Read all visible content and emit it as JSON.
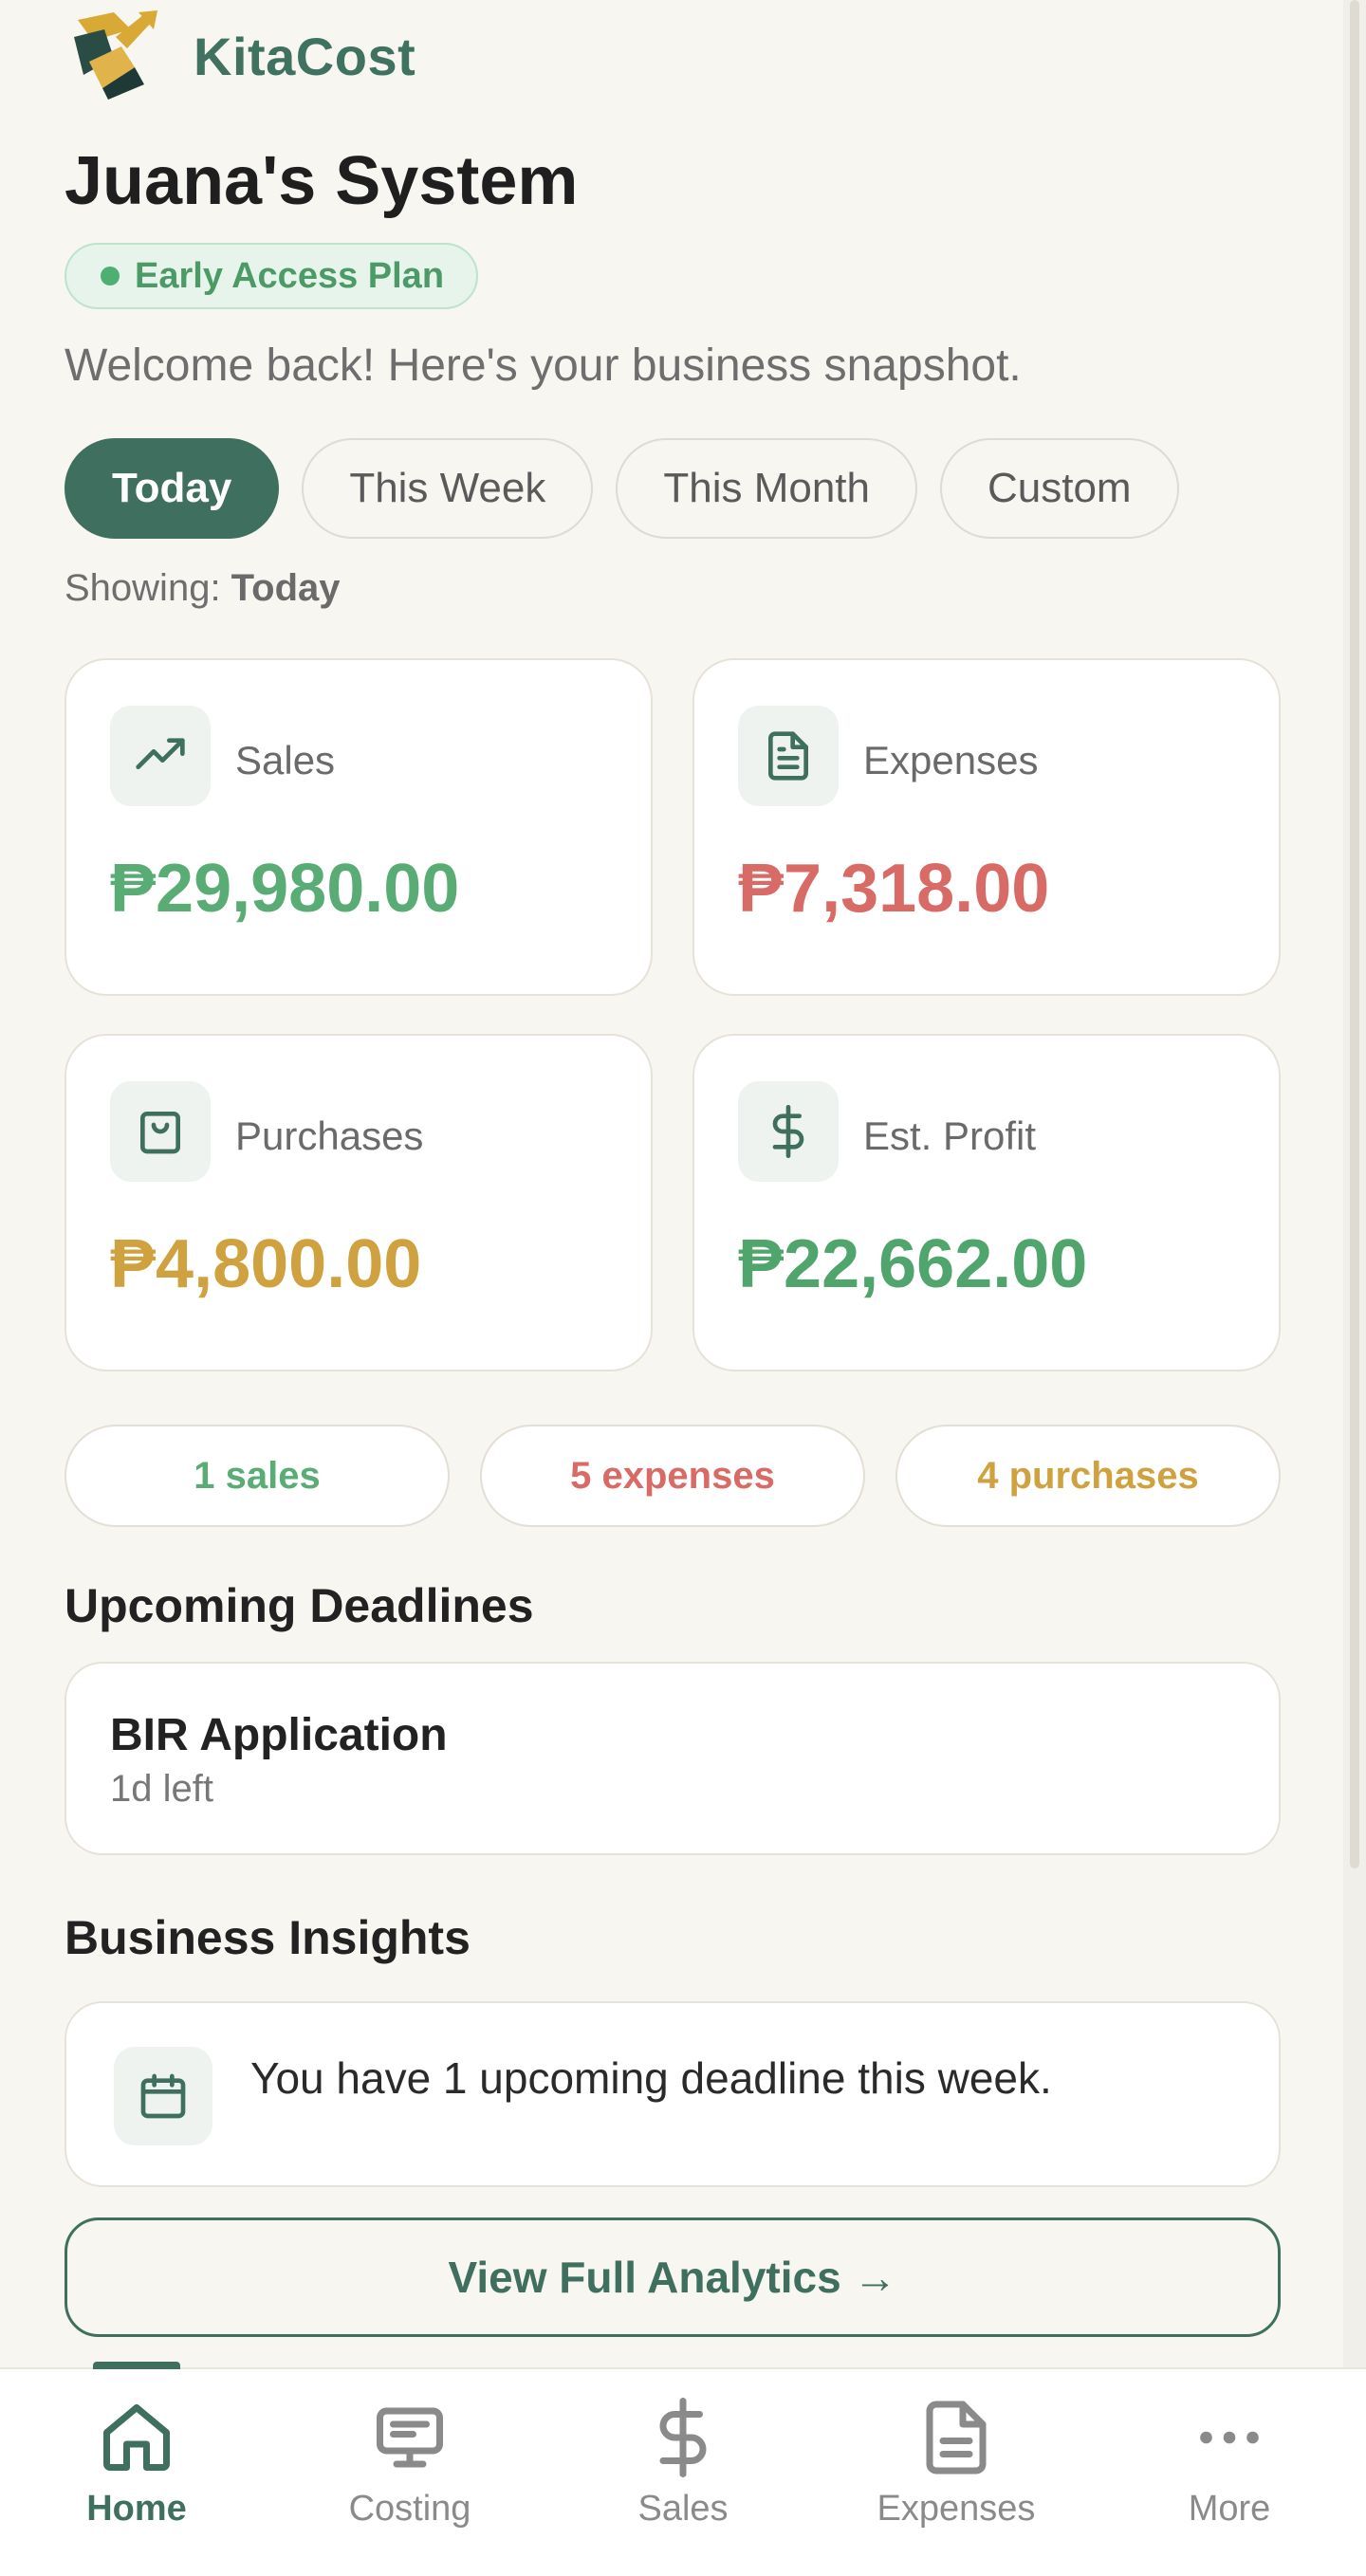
{
  "app": {
    "brand_name": "KitaCost",
    "title": "Juana's System",
    "plan_badge": "Early Access Plan",
    "welcome": "Welcome back! Here's your business snapshot."
  },
  "filters": {
    "options": [
      "Today",
      "This Week",
      "This Month",
      "Custom"
    ],
    "selected": "Today",
    "showing_prefix": "Showing: ",
    "showing_value": "Today"
  },
  "stats": [
    {
      "label": "Sales",
      "value": "₱29,980.00",
      "icon": "trending-up-icon",
      "color": "#59ad74"
    },
    {
      "label": "Expenses",
      "value": "₱7,318.00",
      "icon": "document-icon",
      "color": "#d96b66"
    },
    {
      "label": "Purchases",
      "value": "₱4,800.00",
      "icon": "shopping-bag-icon",
      "color": "#cfa23f"
    },
    {
      "label": "Est. Profit",
      "value": "₱22,662.00",
      "icon": "dollar-icon",
      "color": "#4fa56c"
    }
  ],
  "counts": [
    "1 sales",
    "5 expenses",
    "4 purchases"
  ],
  "deadlines": {
    "title": "Upcoming Deadlines",
    "items": [
      {
        "name": "BIR Application",
        "remaining": "1d left"
      }
    ]
  },
  "insights": {
    "title": "Business Insights",
    "items": [
      {
        "icon": "calendar-icon",
        "text": "You have 1 upcoming deadline this week."
      }
    ]
  },
  "analytics_button": "View Full Analytics →",
  "nav": {
    "items": [
      {
        "label": "Home",
        "icon": "home-icon",
        "active": true
      },
      {
        "label": "Costing",
        "icon": "monitor-icon",
        "active": false
      },
      {
        "label": "Sales",
        "icon": "dollar-icon",
        "active": false
      },
      {
        "label": "Expenses",
        "icon": "document-icon",
        "active": false
      },
      {
        "label": "More",
        "icon": "more-dots-icon",
        "active": false
      }
    ]
  },
  "colors": {
    "brand": "#3e6f5f",
    "background": "#f8f6f1",
    "sales": "#59ad74",
    "expenses": "#d96b66",
    "purchases": "#cfa23f",
    "profit": "#4fa56c"
  }
}
